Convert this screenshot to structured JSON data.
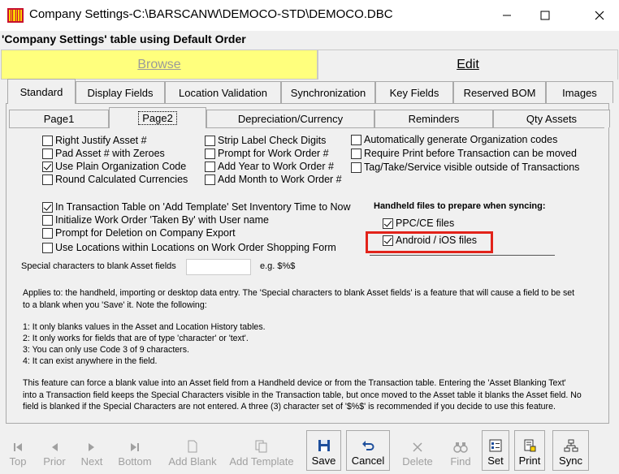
{
  "window": {
    "title": "Company Settings-C:\\BARSCANW\\DEMOCO-STD\\DEMOCO.DBC"
  },
  "header": {
    "table_info": "'Company Settings' table using Default Order"
  },
  "mode_tabs": {
    "browse": "Browse",
    "edit": "Edit"
  },
  "tabs": [
    "Standard",
    "Display Fields",
    "Location Validation",
    "Synchronization",
    "Key Fields",
    "Reserved BOM",
    "Images"
  ],
  "subtabs": [
    "Page1",
    "Page2",
    "Depreciation/Currency",
    "Reminders",
    "Qty Assets"
  ],
  "col1": [
    {
      "label": "Right Justify Asset #",
      "checked": false
    },
    {
      "label": "Pad Asset # with Zeroes",
      "checked": false
    },
    {
      "label": "Use Plain Organization Code",
      "checked": true
    },
    {
      "label": "Round Calculated Currencies",
      "checked": false
    }
  ],
  "col2": [
    {
      "label": "Strip Label Check Digits",
      "checked": false
    },
    {
      "label": "Prompt for Work Order #",
      "checked": false
    },
    {
      "label": "Add Year to Work Order #",
      "checked": false
    },
    {
      "label": "Add Month to Work Order #",
      "checked": false
    }
  ],
  "col3": [
    {
      "label": "Automatically generate Organization codes",
      "checked": false
    },
    {
      "label": "Require Print before Transaction can be moved",
      "checked": false
    },
    {
      "label": "Tag/Take/Service visible outside of Transactions",
      "checked": false
    }
  ],
  "col4": [
    {
      "label": "In Transaction Table on 'Add Template' Set Inventory Time to Now",
      "checked": true
    },
    {
      "label": "Initialize Work Order 'Taken By' with User name",
      "checked": false
    },
    {
      "label": "Prompt for Deletion on Company Export",
      "checked": false
    },
    {
      "label": "Use Locations within Locations on Work Order Shopping Form",
      "checked": false
    }
  ],
  "handheld": {
    "title": "Handheld files to prepare when syncing:",
    "options": [
      {
        "label": "PPC/CE files",
        "checked": true
      },
      {
        "label": "Android / iOS files",
        "checked": true
      }
    ]
  },
  "special": {
    "label": "Special characters to blank Asset fields",
    "value": "",
    "example": "e.g. $%$"
  },
  "notes": [
    "Applies to: the handheld, importing or desktop data entry.  The 'Special characters to blank Asset fields' is a feature that will cause a field to be set",
    "to a blank when you 'Save' it.  Note the following:",
    "1: It only blanks values in the Asset and Location History tables.",
    "2: It only works for fields that are of type 'character' or 'text'.",
    "3: You can only use Code 3 of 9 characters.",
    "4: It can exist anywhere in the field.",
    "This feature can force a blank value into an Asset field from a Handheld device or from the Transaction table.  Entering the 'Asset Blanking Text'",
    "into a Transaction field keeps the Special Characters visible in the Transaction table, but once moved to the Asset table it blanks the Asset field. No",
    "field is blanked if the Special Characters are not entered. A three (3) character set of '$%$' is recommended if you decide to use this feature."
  ],
  "toolbar": [
    {
      "label": "Top",
      "icon": "first-record-icon",
      "enabled": false
    },
    {
      "label": "Prior",
      "icon": "prior-icon",
      "enabled": false
    },
    {
      "label": "Next",
      "icon": "next-icon",
      "enabled": false
    },
    {
      "label": "Bottom",
      "icon": "last-record-icon",
      "enabled": false
    },
    {
      "label": "Add Blank",
      "icon": "blank-page-icon",
      "enabled": false
    },
    {
      "label": "Add Template",
      "icon": "template-icon",
      "enabled": false
    },
    {
      "label": "Save",
      "icon": "floppy-disk-icon",
      "enabled": true
    },
    {
      "label": "Cancel",
      "icon": "undo-icon",
      "enabled": true
    },
    {
      "label": "Delete",
      "icon": "delete-x-icon",
      "enabled": false
    },
    {
      "label": "Find",
      "icon": "binoculars-icon",
      "enabled": false
    },
    {
      "label": "Set",
      "icon": "set-icon",
      "enabled": true
    },
    {
      "label": "Print",
      "icon": "print-icon",
      "enabled": true
    },
    {
      "label": "Sync",
      "icon": "sync-network-icon",
      "enabled": true
    }
  ],
  "colors": {
    "browse_bg": "#ffff7d",
    "highlight": "#e2231a"
  }
}
